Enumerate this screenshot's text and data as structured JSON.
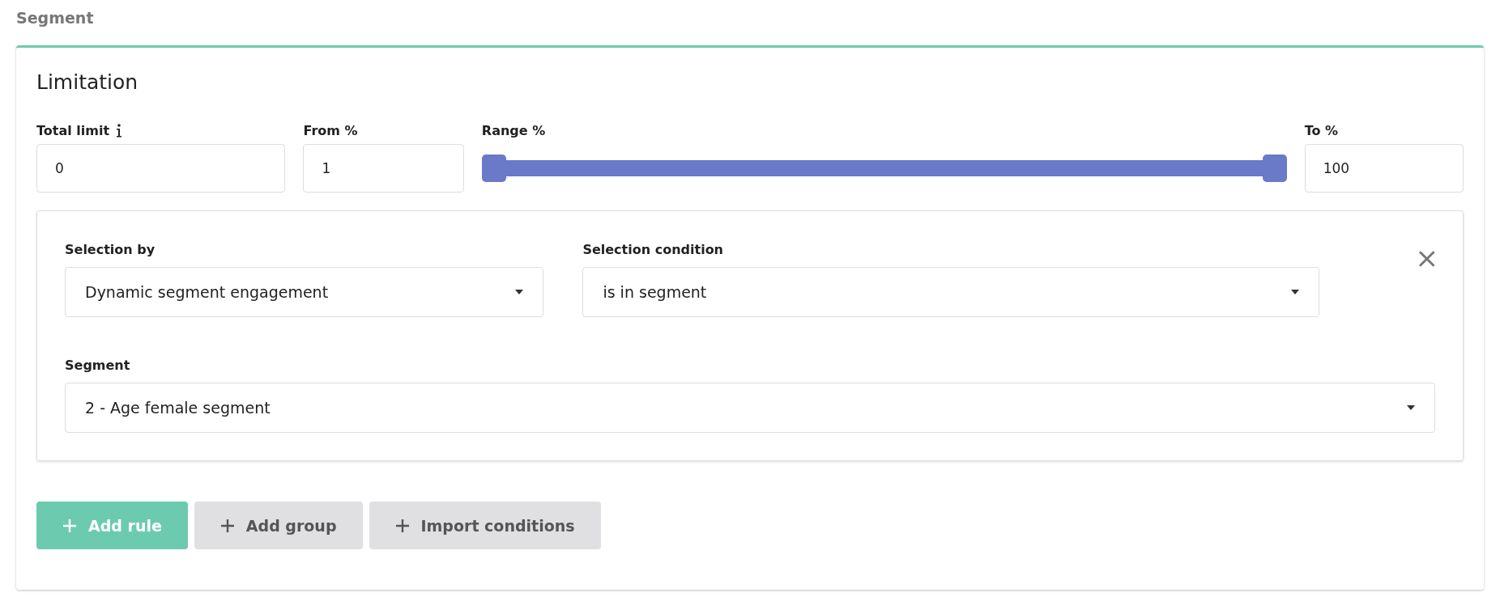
{
  "section_title": "Segment",
  "card": {
    "title": "Limitation",
    "total_limit": {
      "label": "Total limit",
      "value": "0"
    },
    "from": {
      "label": "From %",
      "value": "1"
    },
    "range": {
      "label": "Range %",
      "thumbs": [
        {
          "level": 0
        },
        {
          "level": 1
        }
      ]
    },
    "to": {
      "label": "To %",
      "value": "100"
    },
    "rule": {
      "selection_by": {
        "label": "Selection by",
        "value": "Dynamic segment engagement"
      },
      "selection_condition": {
        "label": "Selection condition",
        "value": "is in segment"
      },
      "segment": {
        "label": "Segment",
        "value": "2 - Age female segment"
      }
    },
    "buttons": [
      {
        "label": "Add rule",
        "kind": "primary"
      },
      {
        "label": "Add group",
        "kind": "secondary"
      },
      {
        "label": "Import conditions",
        "kind": "secondary"
      }
    ]
  }
}
